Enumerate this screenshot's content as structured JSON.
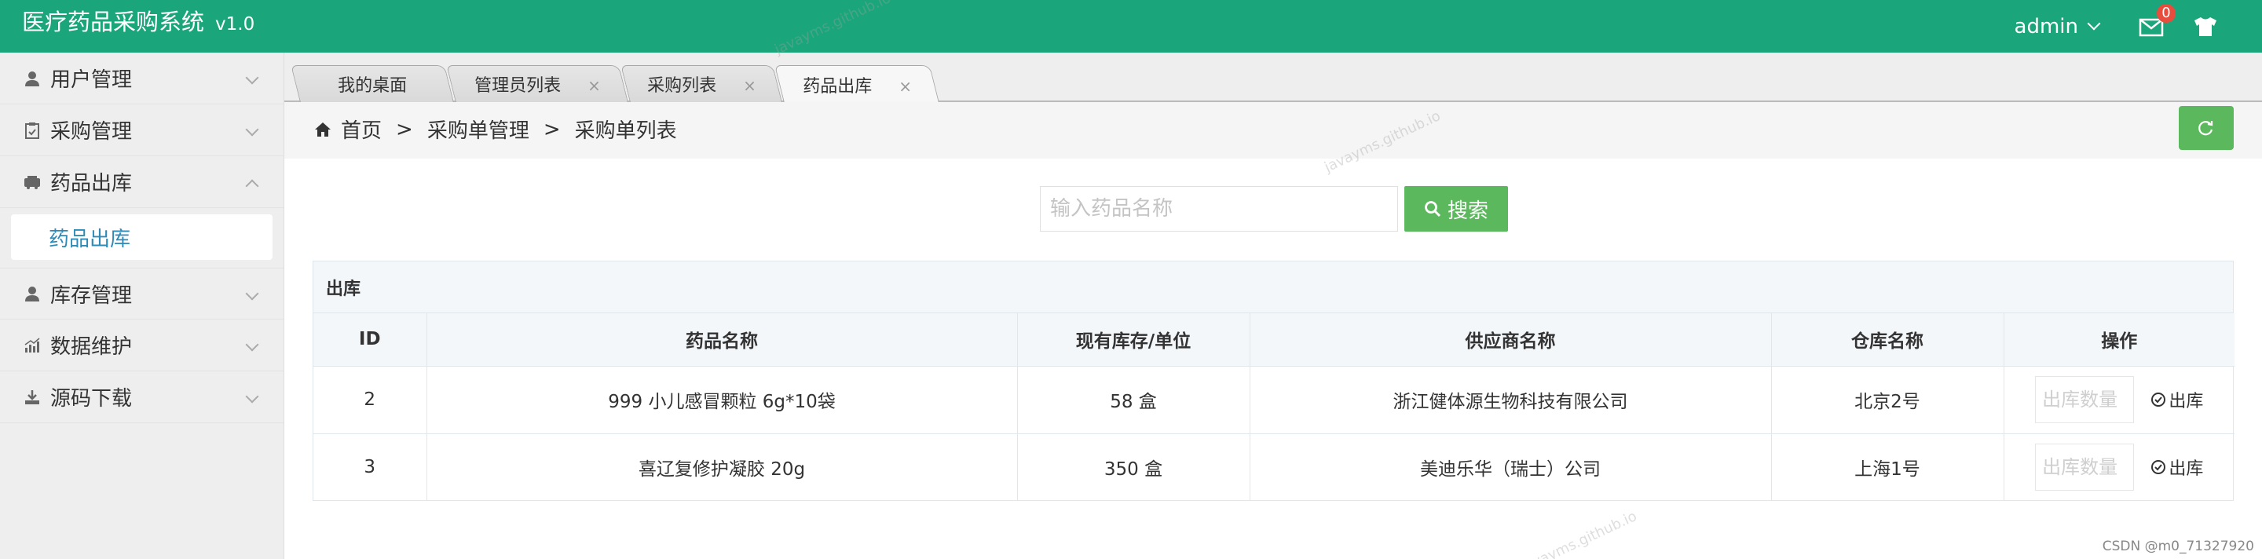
{
  "app": {
    "title": "医疗药品采购系统",
    "version": "v1.0"
  },
  "header": {
    "user": "admin",
    "mail_count": "0"
  },
  "sidebar": {
    "items": [
      {
        "label": "用户管理",
        "icon": "user-icon"
      },
      {
        "label": "采购管理",
        "icon": "clipboard-icon"
      },
      {
        "label": "药品出库",
        "icon": "truck-icon",
        "expanded": true,
        "sub": "药品出库"
      },
      {
        "label": "库存管理",
        "icon": "user-icon"
      },
      {
        "label": "数据维护",
        "icon": "chart-icon"
      },
      {
        "label": "源码下载",
        "icon": "download-icon"
      }
    ]
  },
  "tabs": [
    {
      "label": "我的桌面",
      "closable": false
    },
    {
      "label": "管理员列表",
      "closable": true
    },
    {
      "label": "采购列表",
      "closable": true
    },
    {
      "label": "药品出库",
      "closable": true,
      "active": true
    }
  ],
  "breadcrumb": [
    "首页",
    "采购单管理",
    "采购单列表"
  ],
  "search": {
    "placeholder": "输入药品名称",
    "button": "搜索"
  },
  "panel": {
    "title": "出库",
    "columns": [
      "ID",
      "药品名称",
      "现有库存/单位",
      "供应商名称",
      "仓库名称",
      "操作"
    ],
    "rows": [
      {
        "id": "2",
        "name": "999 小儿感冒颗粒 6g*10袋",
        "stock": "58 盒",
        "supplier": "浙江健体源生物科技有限公司",
        "warehouse": "北京2号",
        "qty_placeholder": "出库数量",
        "action": "出库"
      },
      {
        "id": "3",
        "name": "喜辽复修护凝胶 20g",
        "stock": "350 盒",
        "supplier": "美迪乐华（瑞士）公司",
        "warehouse": "上海1号",
        "qty_placeholder": "出库数量",
        "action": "出库"
      }
    ]
  },
  "watermark": "javayms.github.io",
  "footer_mark": "CSDN @m0_71327920",
  "colors": {
    "header": "#1aa67a",
    "button": "#5cb85c",
    "link": "#2e8bb8"
  }
}
